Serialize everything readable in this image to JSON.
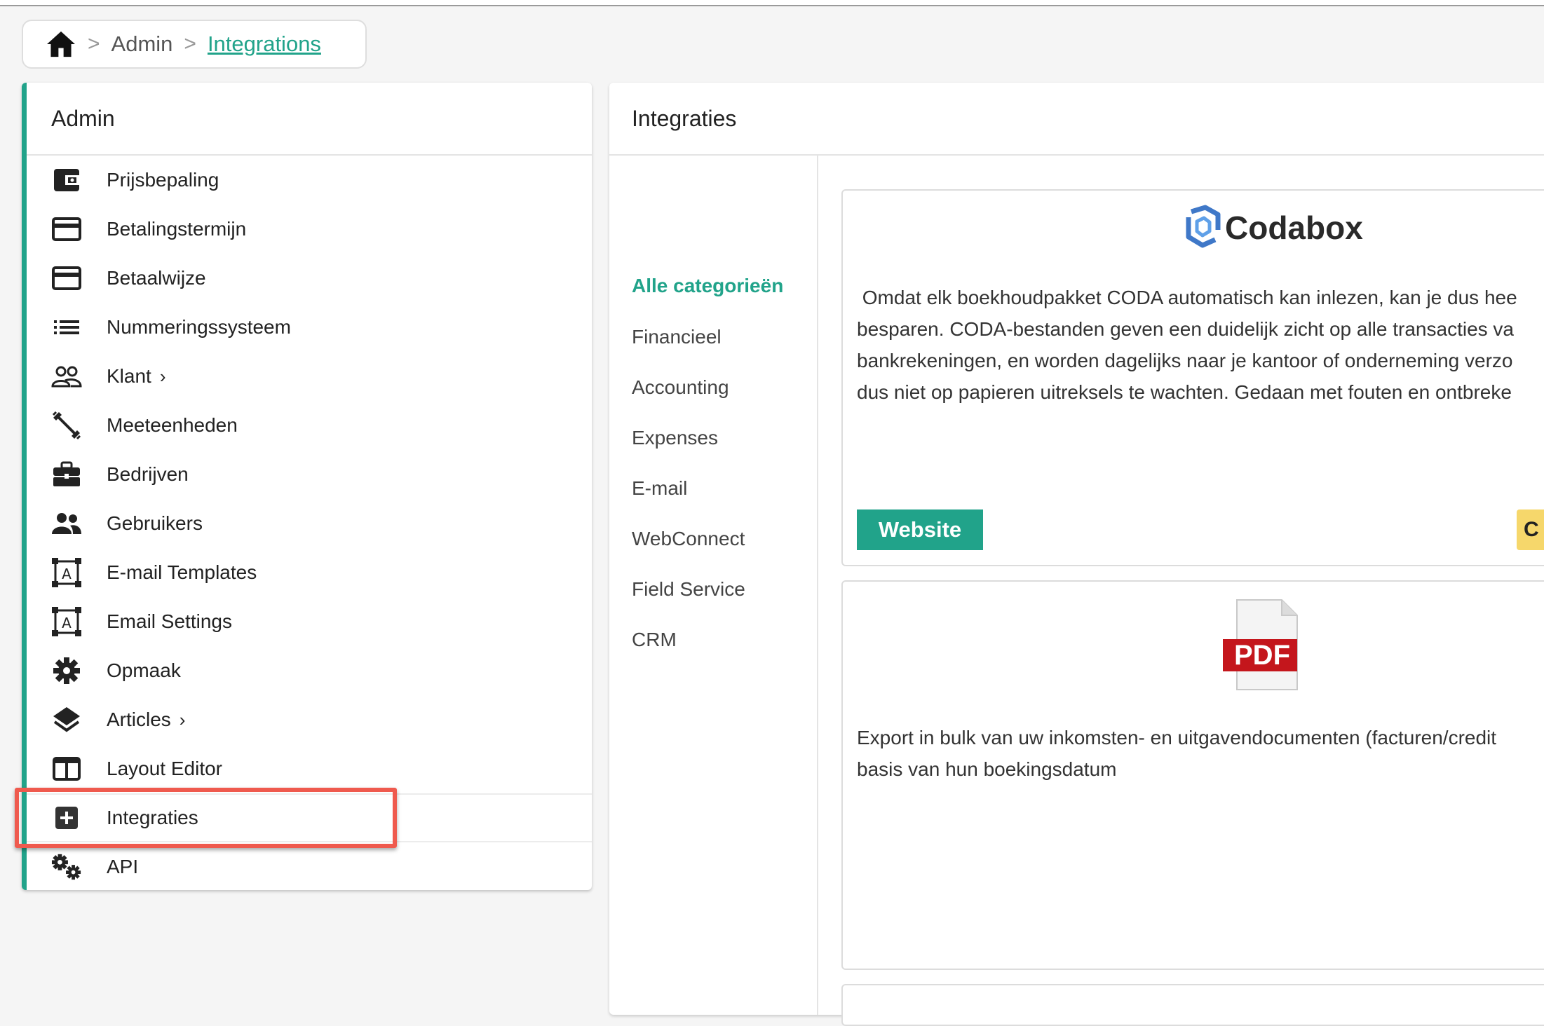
{
  "breadcrumb": {
    "items": [
      "Admin",
      "Integrations"
    ],
    "separator": ">"
  },
  "sidebar": {
    "title": "Admin",
    "items": [
      {
        "label": "Prijsbepaling",
        "icon": "wallet-icon"
      },
      {
        "label": "Betalingstermijn",
        "icon": "credit-card-icon"
      },
      {
        "label": "Betaalwijze",
        "icon": "credit-card-icon"
      },
      {
        "label": "Nummeringssysteem",
        "icon": "list-icon"
      },
      {
        "label": "Klant",
        "icon": "people-outline-icon",
        "has_submenu": true
      },
      {
        "label": "Meeteenheden",
        "icon": "dumbbell-icon"
      },
      {
        "label": "Bedrijven",
        "icon": "briefcase-icon"
      },
      {
        "label": "Gebruikers",
        "icon": "people-icon"
      },
      {
        "label": "E-mail Templates",
        "icon": "text-frame-icon"
      },
      {
        "label": "Email Settings",
        "icon": "text-frame-icon"
      },
      {
        "label": "Opmaak",
        "icon": "gear-icon"
      },
      {
        "label": "Articles",
        "icon": "layers-icon",
        "has_submenu": true
      },
      {
        "label": "Layout Editor",
        "icon": "layout-icon"
      },
      {
        "label": "Integraties",
        "icon": "plus-box-icon",
        "active": true
      },
      {
        "label": "API",
        "icon": "gears-icon"
      }
    ]
  },
  "main": {
    "title": "Integraties",
    "categories": [
      {
        "label": "Alle categorieën",
        "active": true
      },
      {
        "label": "Financieel"
      },
      {
        "label": "Accounting"
      },
      {
        "label": "Expenses"
      },
      {
        "label": "E-mail"
      },
      {
        "label": "WebConnect"
      },
      {
        "label": "Field Service"
      },
      {
        "label": "CRM"
      }
    ],
    "cards": [
      {
        "logo_text": "Codabox",
        "description_lines": [
          " Omdat elk boekhoudpakket CODA automatisch kan inlezen, kan je dus hee",
          "besparen. CODA-bestanden geven een duidelijk zicht op alle transacties va",
          "bankrekeningen, en worden dagelijks naar je kantoor of onderneming verzo",
          "dus niet op papieren uitreksels te wachten. Gedaan met fouten en ontbreke"
        ],
        "website_label": "Website",
        "second_button_label": "C"
      },
      {
        "logo_text": "PDF",
        "description_lines": [
          "Export in bulk van uw inkomsten- en uitgavendocumenten (facturen/credit",
          "basis van hun boekingsdatum"
        ]
      }
    ]
  },
  "colors": {
    "accent": "#21a38a",
    "highlight": "#ef5a4e",
    "codabox_blue": "#3f78c8",
    "pdf_red": "#c4161c",
    "button_yellow": "#f6d76b"
  }
}
